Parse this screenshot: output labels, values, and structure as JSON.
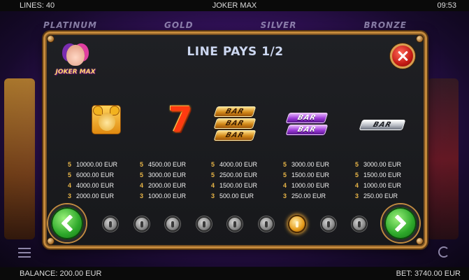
{
  "top_bar": {
    "lines": "LINES: 40",
    "title": "JOKER MAX",
    "clock": "09:53"
  },
  "background": {
    "jackpots": [
      "PLATINUM",
      "GOLD",
      "SILVER",
      "BRONZE"
    ]
  },
  "panel": {
    "title": "LINE PAYS 1/2",
    "logo_text": "JOKER MAX",
    "symbols": [
      {
        "name": "jester",
        "pays": [
          {
            "count": "5",
            "amount": "10000.00 EUR"
          },
          {
            "count": "5",
            "amount": "6000.00 EUR"
          },
          {
            "count": "4",
            "amount": "4000.00 EUR"
          },
          {
            "count": "3",
            "amount": "2000.00 EUR"
          }
        ]
      },
      {
        "name": "seven",
        "glyph": "7",
        "pays": [
          {
            "count": "5",
            "amount": "4500.00 EUR"
          },
          {
            "count": "5",
            "amount": "3000.00 EUR"
          },
          {
            "count": "4",
            "amount": "2000.00 EUR"
          },
          {
            "count": "3",
            "amount": "1000.00 EUR"
          }
        ]
      },
      {
        "name": "triple-bar",
        "bar_text": "BAR",
        "pays": [
          {
            "count": "5",
            "amount": "4000.00 EUR"
          },
          {
            "count": "5",
            "amount": "2500.00 EUR"
          },
          {
            "count": "4",
            "amount": "1500.00 EUR"
          },
          {
            "count": "3",
            "amount": "500.00 EUR"
          }
        ]
      },
      {
        "name": "double-bar",
        "bar_text": "BAR",
        "pays": [
          {
            "count": "5",
            "amount": "3000.00 EUR"
          },
          {
            "count": "5",
            "amount": "1500.00 EUR"
          },
          {
            "count": "4",
            "amount": "1000.00 EUR"
          },
          {
            "count": "3",
            "amount": "250.00 EUR"
          }
        ]
      },
      {
        "name": "single-bar",
        "bar_text": "BAR",
        "pays": [
          {
            "count": "5",
            "amount": "3000.00 EUR"
          },
          {
            "count": "5",
            "amount": "1500.00 EUR"
          },
          {
            "count": "4",
            "amount": "1000.00 EUR"
          },
          {
            "count": "3",
            "amount": "250.00 EUR"
          }
        ]
      }
    ],
    "pagination": {
      "total_dots": 9,
      "active_index": 6
    }
  },
  "bottom_bar": {
    "balance": "BALANCE: 200.00 EUR",
    "bet": "BET: 3740.00 EUR"
  },
  "colors": {
    "frame": "#c58a3c",
    "panel_bg": "#1b1c20",
    "count_gold": "#e8b547",
    "close_red": "#c41a14",
    "arrow_green": "#2da82a",
    "title": "#ccd7f0"
  }
}
